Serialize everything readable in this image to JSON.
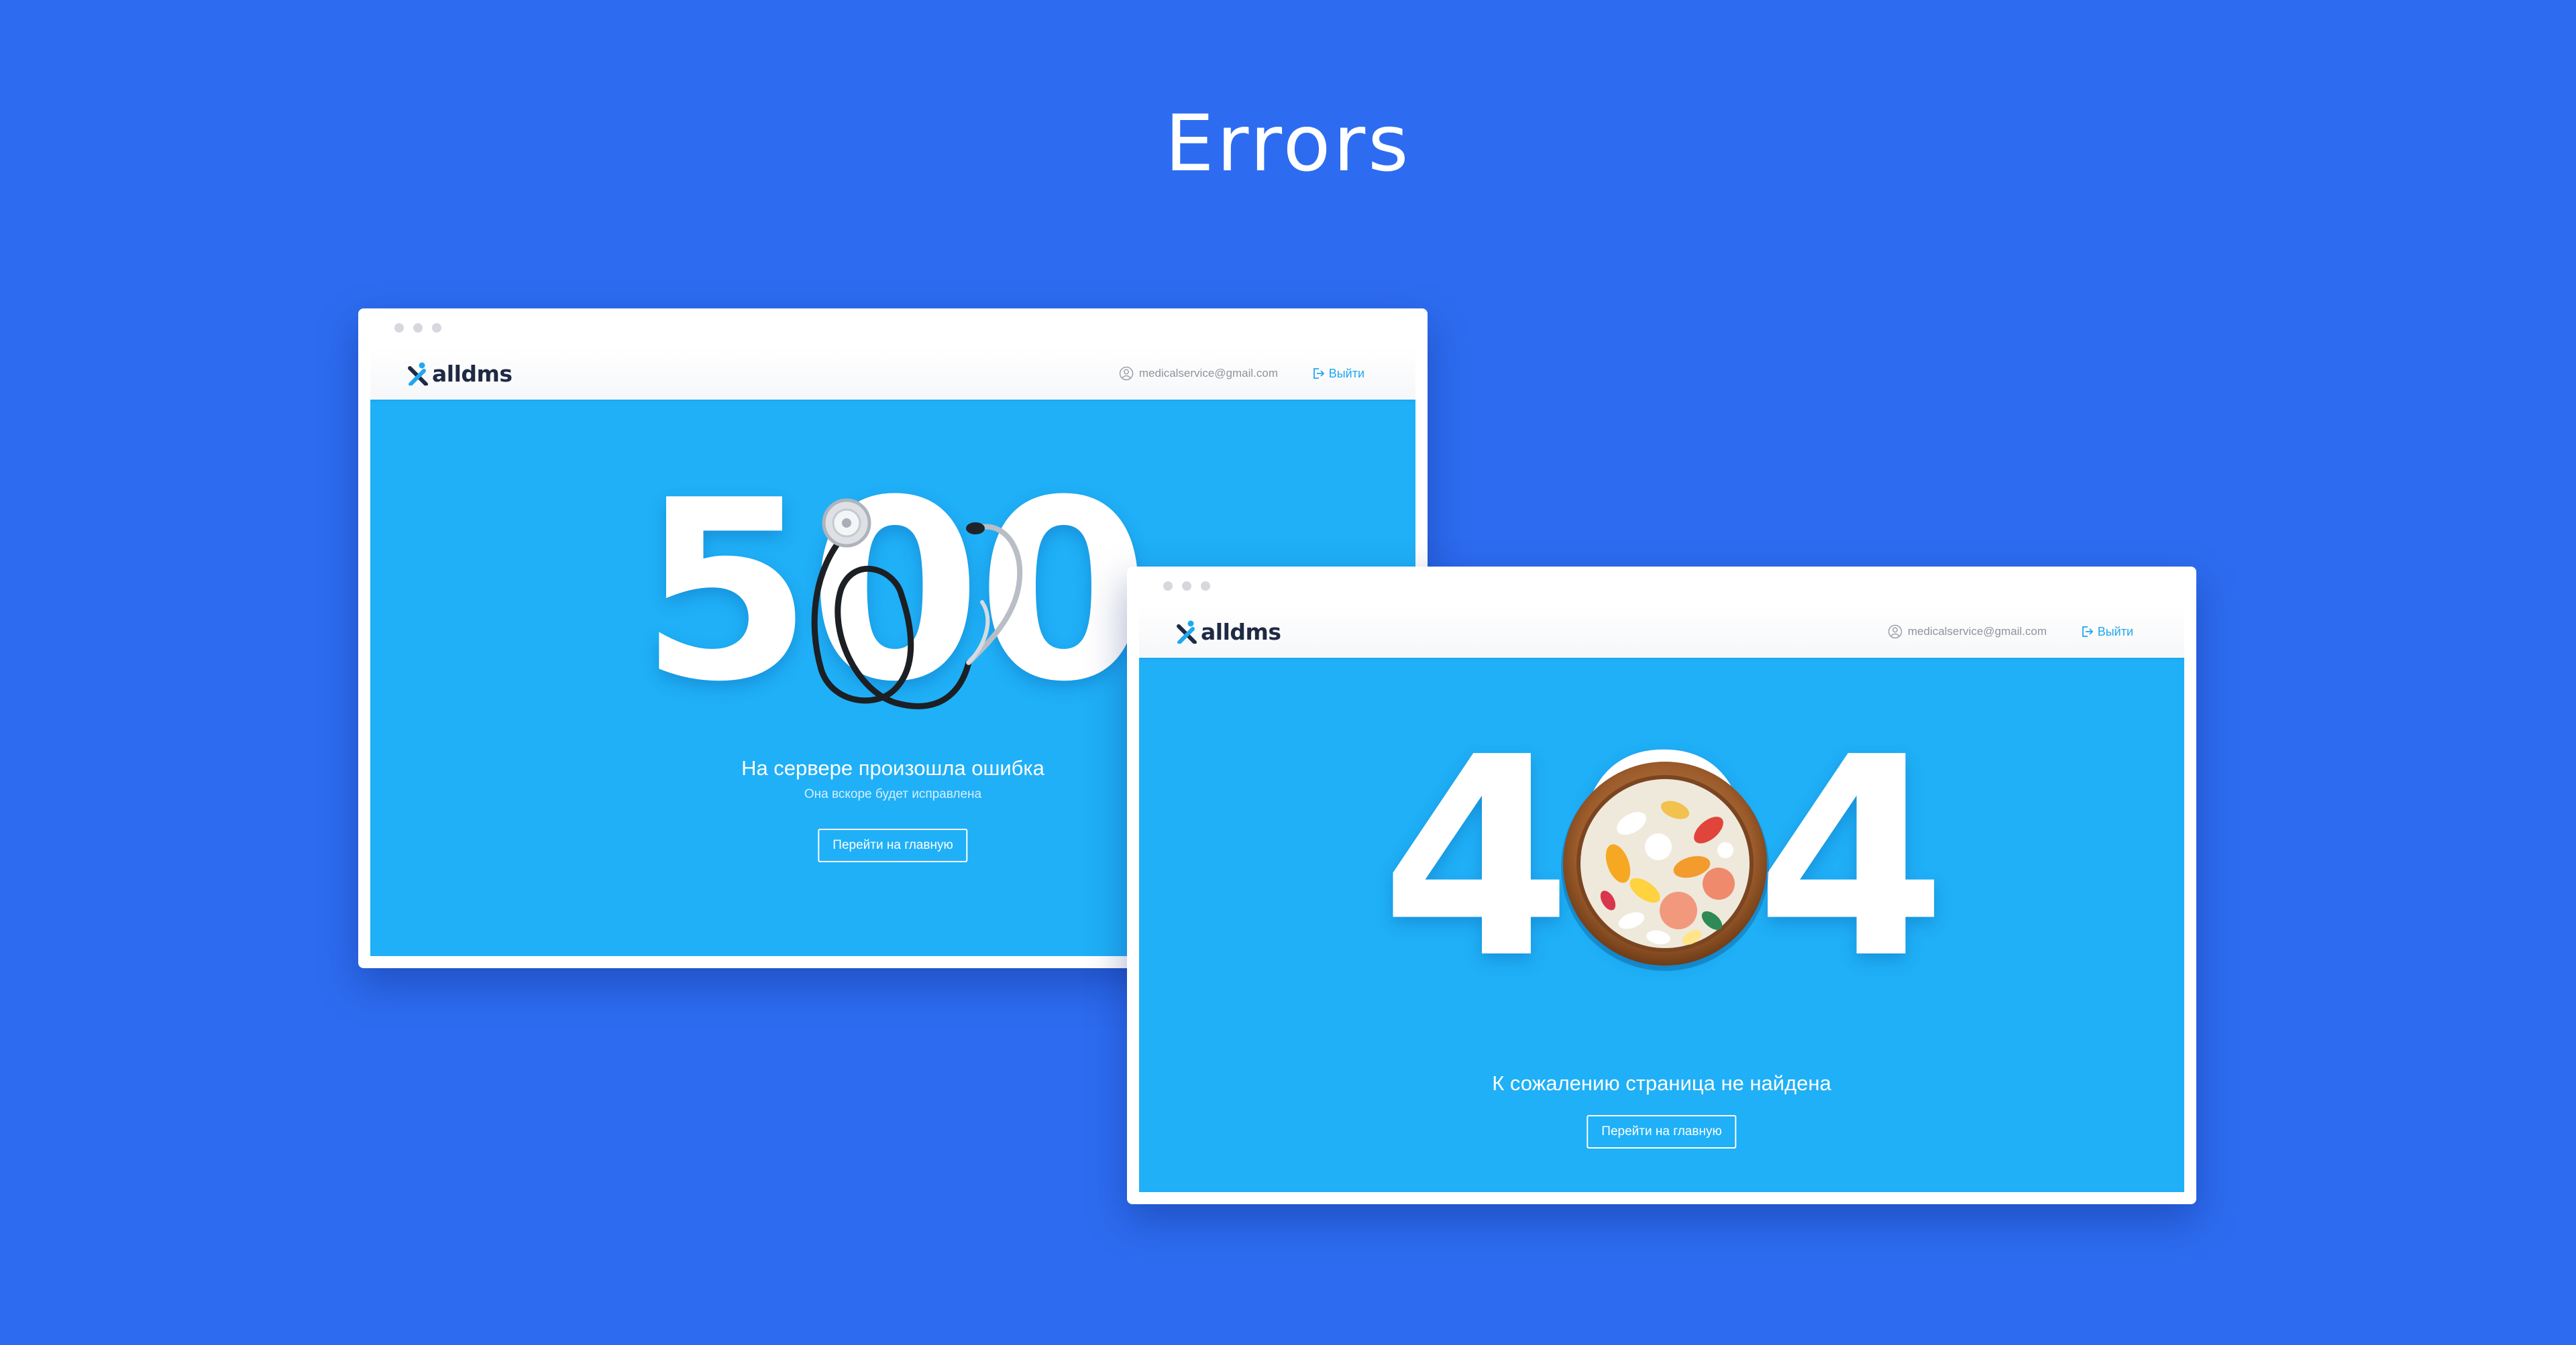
{
  "page_title": "Errors",
  "colors": {
    "page_background": "#2d6cf0",
    "viewport_background": "#1fb0f7",
    "logo_text": "#1f2a44",
    "logo_accent": "#1fa8ee",
    "logout_link": "#1fa8ee"
  },
  "error_500": {
    "brand": "alldms",
    "user_email": "medicalservice@gmail.com",
    "logout_label": "Выйти",
    "code": "500",
    "message": "На сервере произошла ошибка",
    "submessage": "Она вскоре будет исправлена",
    "button_label": "Перейти на главную",
    "illustration": "stethoscope"
  },
  "error_404": {
    "brand": "alldms",
    "user_email": "medicalservice@gmail.com",
    "logout_label": "Выйти",
    "code": "404",
    "message": "К сожалению страница не найдена",
    "button_label": "Перейти на главную",
    "illustration": "bowl-of-pills"
  },
  "icons": {
    "logo": "person-x-logo-icon",
    "user": "user-circle-icon",
    "logout": "logout-icon"
  }
}
